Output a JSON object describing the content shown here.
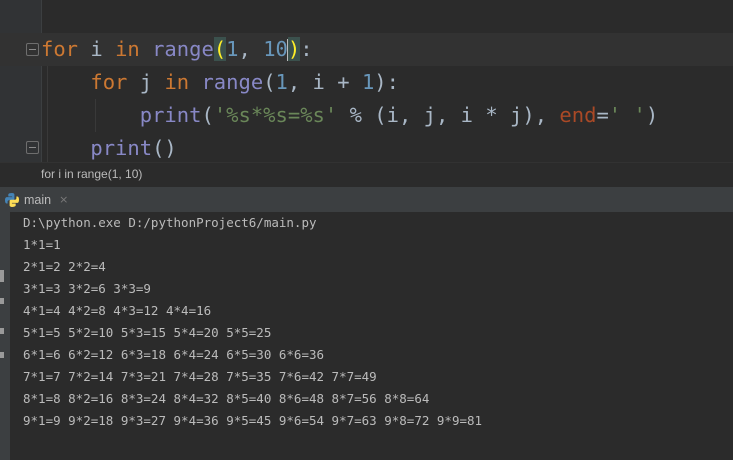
{
  "editor": {
    "line1": {
      "kw_for": "for",
      "var_i": " i ",
      "kw_in": "in",
      "sp": " ",
      "range": "range",
      "open": "(",
      "n1": "1",
      "comma": ", ",
      "n2a": "1",
      "n2b": "0",
      "close": ")",
      "colon": ":"
    },
    "line2": {
      "indent": "    ",
      "kw_for": "for",
      "var_j": " j ",
      "kw_in": "in",
      "sp": " ",
      "range": "range",
      "open": "(",
      "n1": "1",
      "mid": ", i + ",
      "n2": "1",
      "close": "):"
    },
    "line3": {
      "indent": "        ",
      "print": "print",
      "open": "(",
      "str": "'%s*%s=%s'",
      "mid": " % (i, j, i * j), ",
      "param": "end",
      "eq": "=",
      "str2": "' '",
      "close": ")"
    },
    "line4": {
      "indent": "    ",
      "print": "print",
      "parens": "()"
    }
  },
  "breadcrumb": "for i in range(1, 10)",
  "run_tab": {
    "label": "main",
    "close": "×"
  },
  "console": {
    "lines": [
      "D:\\python.exe D:/pythonProject6/main.py",
      "1*1=1",
      "2*1=2 2*2=4",
      "3*1=3 3*2=6 3*3=9",
      "4*1=4 4*2=8 4*3=12 4*4=16",
      "5*1=5 5*2=10 5*3=15 5*4=20 5*5=25",
      "6*1=6 6*2=12 6*3=18 6*4=24 6*5=30 6*6=36",
      "7*1=7 7*2=14 7*3=21 7*4=28 7*5=35 7*6=42 7*7=49",
      "8*1=8 8*2=16 8*3=24 8*4=32 8*5=40 8*6=48 8*7=56 8*8=64",
      "9*1=9 9*2=18 9*3=27 9*4=36 9*5=45 9*6=54 9*7=63 9*8=72 9*9=81"
    ]
  },
  "colors": {
    "keyword": "#cc7832",
    "number": "#6897bb",
    "string": "#6a8759",
    "builtin": "#8888c6",
    "param": "#aa4926",
    "text": "#a9b7c6",
    "background": "#2b2b2b"
  }
}
